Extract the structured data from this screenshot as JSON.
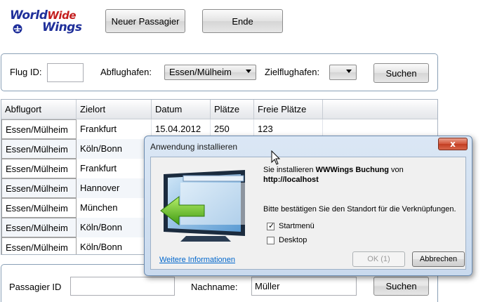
{
  "logo": {
    "line1": "World",
    "line1b": "Wide",
    "line2": "Wings"
  },
  "toolbar": {
    "new_passenger": "Neuer Passagier",
    "end": "Ende"
  },
  "flight_search": {
    "flug_id_label": "Flug ID:",
    "flug_id_value": "",
    "abflug_label": "Abflughafen:",
    "abflug_value": "Essen/Mülheim",
    "ziel_label": "Zielflughafen:",
    "ziel_value": "",
    "search_button": "Suchen"
  },
  "grid": {
    "columns": [
      "Abflugort",
      "Zielort",
      "Datum",
      "Plätze",
      "Freie Plätze"
    ],
    "rows": [
      [
        "Essen/Mülheim",
        "Frankfurt",
        "15.04.2012",
        "250",
        "123"
      ],
      [
        "Essen/Mülheim",
        "Köln/Bonn",
        "",
        "",
        ""
      ],
      [
        "Essen/Mülheim",
        "Frankfurt",
        "",
        "",
        ""
      ],
      [
        "Essen/Mülheim",
        "Hannover",
        "",
        "",
        ""
      ],
      [
        "Essen/Mülheim",
        "München",
        "",
        "",
        ""
      ],
      [
        "Essen/Mülheim",
        "Köln/Bonn",
        "",
        "",
        ""
      ],
      [
        "Essen/Mülheim",
        "Köln/Bonn",
        "",
        "",
        ""
      ]
    ]
  },
  "passenger_search": {
    "id_label": "Passagier ID",
    "id_value": "",
    "nachname_label": "Nachname:",
    "nachname_value": "Müller",
    "search_button": "Suchen"
  },
  "dialog": {
    "title": "Anwendung installieren",
    "line1_prefix": "Sie installieren ",
    "app_name": "WWWings Buchung",
    "line1_suffix": " von",
    "source": "http://localhost",
    "confirm_text": "Bitte bestätigen Sie den Standort für die Verknüpfungen.",
    "startmenu_label": "Startmenü",
    "startmenu_checked": true,
    "desktop_label": "Desktop",
    "desktop_checked": false,
    "more_info_link": "Weitere Informationen",
    "ok_button": "OK (1)",
    "cancel_button": "Abbrechen",
    "close_glyph": "x",
    "check_glyph": "✓"
  }
}
